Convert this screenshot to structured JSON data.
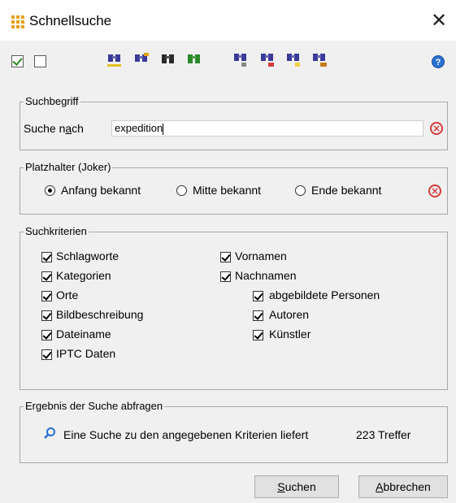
{
  "window": {
    "title": "Schnellsuche",
    "close_glyph": "✕"
  },
  "toolbar": {
    "check_all_icon": "checkbox-checked-icon",
    "uncheck_all_icon": "checkbox-empty-icon",
    "tool_icons": [
      "binoculars-icon",
      "binoculars-icon",
      "binoculars-icon",
      "binoculars-icon",
      "binoculars-icon",
      "binoculars-icon",
      "binoculars-icon",
      "binoculars-icon"
    ],
    "help_glyph": "?"
  },
  "suchbegriff": {
    "legend": "Suchbegriff",
    "label_pre": "Suche n",
    "label_mnemonic": "a",
    "label_post": "ch",
    "value": "expedition"
  },
  "platzhalter": {
    "legend": "Platzhalter (Joker)",
    "options": [
      "Anfang bekannt",
      "Mitte bekannt",
      "Ende bekannt"
    ],
    "selected": "Anfang bekannt"
  },
  "suchkriterien": {
    "legend": "Suchkriterien",
    "left": [
      "Schlagworte",
      "Kategorien",
      "Orte",
      "Bildbeschreibung",
      "Dateiname",
      "IPTC Daten"
    ],
    "right": [
      "Vornamen",
      "Nachnamen"
    ],
    "sub": [
      "abgebildete Personen",
      "Autoren",
      "Künstler"
    ]
  },
  "ergebnis": {
    "legend": "Ergebnis der Suche abfragen",
    "text": "Eine Suche zu den angegebenen Kriterien liefert",
    "count": "223 Treffer"
  },
  "buttons": {
    "search_mnemonic": "S",
    "search_rest": "uchen",
    "cancel_mnemonic": "A",
    "cancel_rest": "bbrechen"
  },
  "colors": {
    "accent_icon": "#e6a019",
    "clear_red": "#d63b3b",
    "help_blue": "#2a6fd0"
  }
}
